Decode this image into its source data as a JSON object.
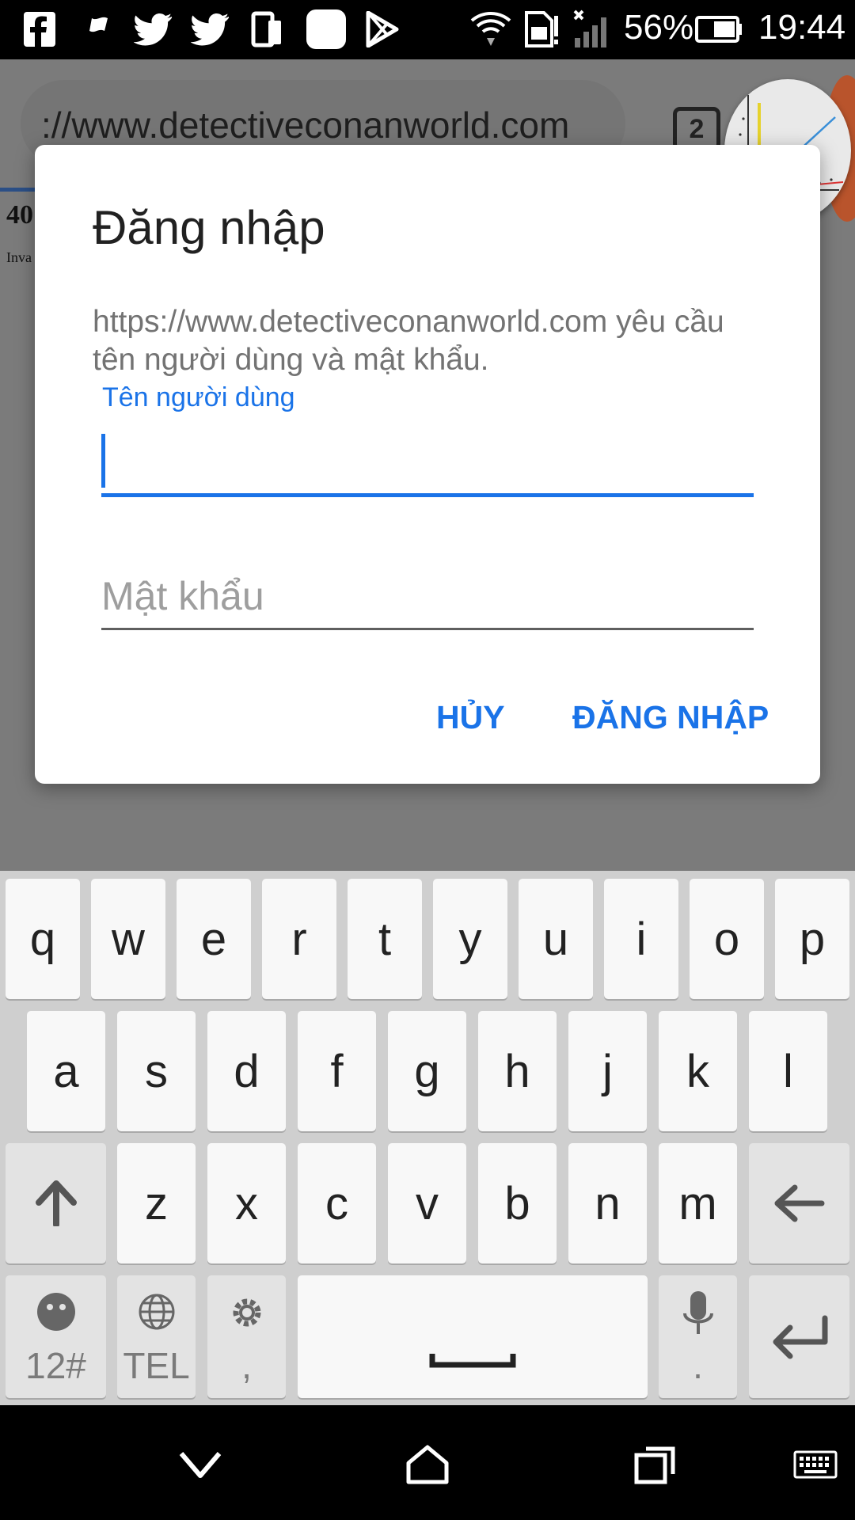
{
  "status_bar": {
    "battery_percent": "56%",
    "time": "19:44",
    "icons": [
      "facebook-icon",
      "flag-icon",
      "twitter-icon",
      "twitter-icon",
      "device-icon",
      "app-icon",
      "play-store-icon",
      "wifi-icon",
      "sim-icon",
      "signal-icon",
      "battery-icon"
    ]
  },
  "browser": {
    "url": "://www.detectiveconanworld.com",
    "tab_count": "2",
    "page_heading": "40",
    "page_subtext": "Inva"
  },
  "dialog": {
    "title": "Đăng nhập",
    "message": "https://www.detectiveconanworld.com yêu cầu tên người dùng và mật khẩu.",
    "username_label": "Tên người dùng",
    "username_value": "",
    "password_placeholder": "Mật khẩu",
    "cancel_label": "HỦY",
    "login_label": "ĐĂNG NHẬP"
  },
  "keyboard": {
    "row1": [
      "q",
      "w",
      "e",
      "r",
      "t",
      "y",
      "u",
      "i",
      "o",
      "p"
    ],
    "row2": [
      "a",
      "s",
      "d",
      "f",
      "g",
      "h",
      "j",
      "k",
      "l"
    ],
    "row3": [
      "z",
      "x",
      "c",
      "v",
      "b",
      "n",
      "m"
    ],
    "symbols_label": "12#",
    "tel_label": "TEL",
    "comma_label": ",",
    "period_label": "."
  },
  "colors": {
    "accent": "#1a73e8",
    "scrim": "#7b7b7b",
    "keyboard_bg": "#cfcfcf"
  }
}
